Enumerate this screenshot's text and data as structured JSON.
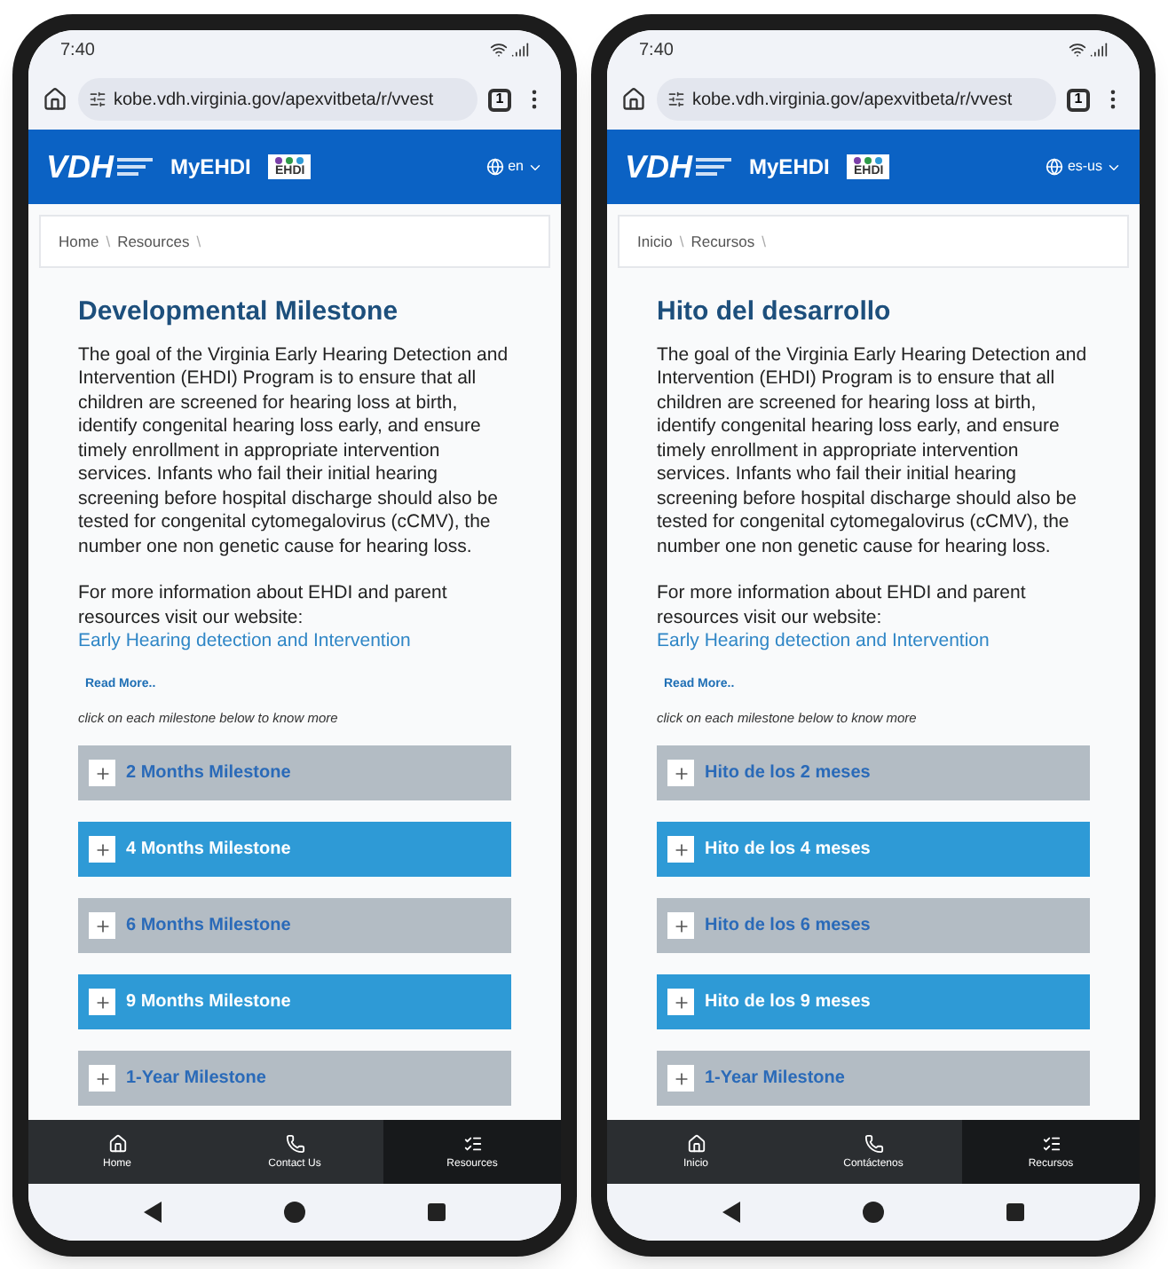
{
  "phones": [
    {
      "status_time": "7:40",
      "url": "kobe.vdh.virginia.gov/apexvitbeta/r/vvest",
      "tab_count": "1",
      "header": {
        "brand": "VDH",
        "app_name": "MyEHDI",
        "badge": "EHDI",
        "language": "en"
      },
      "breadcrumb": [
        "Home",
        "Resources"
      ],
      "breadcrumb_separator": "\\",
      "title": "Developmental Milestone",
      "intro": "The goal of the Virginia Early Hearing Detection and Intervention (EHDI) Program is to ensure that all children are screened for hearing loss at birth, identify congenital hearing loss early, and ensure timely enrollment in appropriate intervention services. Infants who fail their initial hearing screening before hospital discharge should also be tested for congenital cytomegalovirus (cCMV), the number one non genetic cause for hearing loss.",
      "more_info": "For more information about EHDI and parent resources visit our website:",
      "link": "Early Hearing detection and Intervention",
      "read_more": "Read More..",
      "instruction": "click on each milestone below to know more",
      "milestones": [
        {
          "label": "2 Months Milestone",
          "color": "#b3bcc4"
        },
        {
          "label": "4 Months Milestone",
          "color": "#2e9ad6"
        },
        {
          "label": "6 Months Milestone",
          "color": "#b3bcc4"
        },
        {
          "label": "9 Months Milestone",
          "color": "#2e9ad6"
        },
        {
          "label": "1-Year Milestone",
          "color": "#b3bcc4"
        }
      ],
      "nav": [
        {
          "label": "Home",
          "kind": "home",
          "selected": false
        },
        {
          "label": "Contact Us",
          "kind": "phone",
          "selected": false
        },
        {
          "label": "Resources",
          "kind": "list",
          "selected": true
        }
      ]
    },
    {
      "status_time": "7:40",
      "url": "kobe.vdh.virginia.gov/apexvitbeta/r/vvest",
      "tab_count": "1",
      "header": {
        "brand": "VDH",
        "app_name": "MyEHDI",
        "badge": "EHDI",
        "language": "es-us"
      },
      "breadcrumb": [
        "Inicio",
        "Recursos"
      ],
      "breadcrumb_separator": "\\",
      "title": "Hito del desarrollo",
      "intro": "The goal of the Virginia Early Hearing Detection and Intervention (EHDI) Program is to ensure that all children are screened for hearing loss at birth, identify congenital hearing loss early, and ensure timely enrollment in appropriate intervention services. Infants who fail their initial hearing screening before hospital discharge should also be tested for congenital cytomegalovirus (cCMV), the number one non genetic cause for hearing loss.",
      "more_info": "For more information about EHDI and parent resources visit our website:",
      "link": "Early Hearing detection and Intervention",
      "read_more": "Read More..",
      "instruction": "click on each milestone below to know more",
      "milestones": [
        {
          "label": "Hito de los 2 meses",
          "color": "#b3bcc4"
        },
        {
          "label": "Hito de los 4 meses",
          "color": "#2e9ad6"
        },
        {
          "label": "Hito de los 6 meses",
          "color": "#b3bcc4"
        },
        {
          "label": "Hito de los 9 meses",
          "color": "#2e9ad6"
        },
        {
          "label": "1-Year Milestone",
          "color": "#b3bcc4"
        }
      ],
      "nav": [
        {
          "label": "Inicio",
          "kind": "home",
          "selected": false
        },
        {
          "label": "Contáctenos",
          "kind": "phone",
          "selected": false
        },
        {
          "label": "Recursos",
          "kind": "list",
          "selected": true
        }
      ]
    }
  ]
}
